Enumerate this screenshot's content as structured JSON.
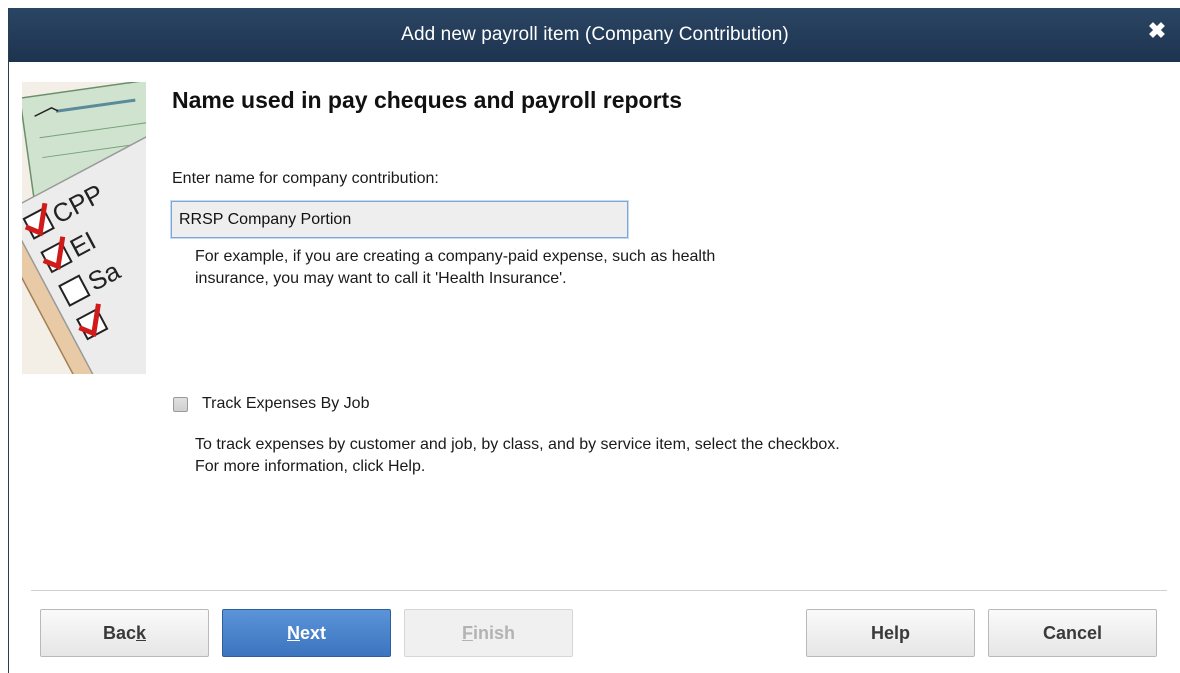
{
  "window": {
    "title": "Add new payroll item (Company Contribution)",
    "close_glyph": "✖"
  },
  "illustration": {
    "icon": "payroll-checklist-icon",
    "labels": [
      "CPP",
      "EI",
      "Sa"
    ]
  },
  "main": {
    "heading": "Name used in pay cheques and payroll reports",
    "name_label": "Enter name for company contribution:",
    "name_value": "RRSP Company Portion",
    "hint_line1": "For example, if you are creating a company-paid expense, such as health",
    "hint_line2": "insurance, you may want to call it 'Health Insurance'.",
    "track_label": "Track Expenses By Job",
    "track_checked": false,
    "track_hint_line1": "To track expenses by customer and job, by class, and by service item, select the checkbox.",
    "track_hint_line2": "For more information, click Help."
  },
  "buttons": {
    "back": {
      "pre": "Bac",
      "mnemonic": "k",
      "post": ""
    },
    "next": {
      "pre": "",
      "mnemonic": "N",
      "post": "ext"
    },
    "finish": {
      "pre": "",
      "mnemonic": "F",
      "post": "inish"
    },
    "help": "Help",
    "cancel": "Cancel"
  },
  "colors": {
    "titlebar": "#1d3450",
    "primary_button": "#3c74bf",
    "disabled_text": "#b3b3b3"
  }
}
